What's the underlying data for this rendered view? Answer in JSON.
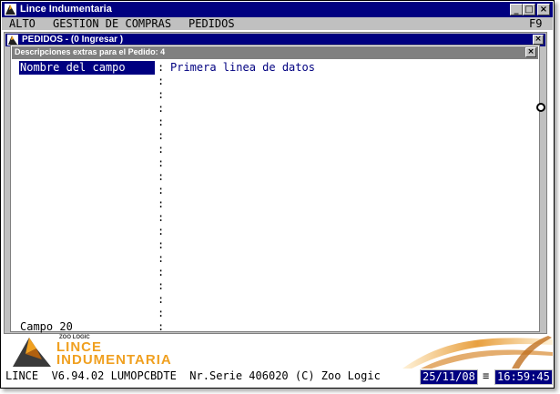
{
  "window": {
    "title": "Lince Indumentaria",
    "minimize_label": "_",
    "maximize_label": "□",
    "close_label": "×"
  },
  "menu": {
    "items": [
      "ALTO",
      "GESTION DE COMPRAS",
      "PEDIDOS"
    ],
    "shortcut": "F9"
  },
  "pedidos_window": {
    "title": "PEDIDOS - (0  Ingresar )",
    "close_label": "×"
  },
  "descripciones_window": {
    "title": "Descripciones extras para el Pedido: 4",
    "close_label": "×"
  },
  "fields": {
    "separator": ":",
    "rows": [
      {
        "name": "Nombre del campo",
        "value": "Primera linea de datos",
        "selected": true
      },
      {
        "name": "",
        "value": ""
      },
      {
        "name": "",
        "value": ""
      },
      {
        "name": "",
        "value": ""
      },
      {
        "name": "",
        "value": ""
      },
      {
        "name": "",
        "value": ""
      },
      {
        "name": "",
        "value": ""
      },
      {
        "name": "",
        "value": ""
      },
      {
        "name": "",
        "value": ""
      },
      {
        "name": "",
        "value": ""
      },
      {
        "name": "",
        "value": ""
      },
      {
        "name": "",
        "value": ""
      },
      {
        "name": "",
        "value": ""
      },
      {
        "name": "",
        "value": ""
      },
      {
        "name": "",
        "value": ""
      },
      {
        "name": "",
        "value": ""
      },
      {
        "name": "",
        "value": ""
      },
      {
        "name": "",
        "value": ""
      },
      {
        "name": "",
        "value": ""
      },
      {
        "name": "Campo 20",
        "value": ""
      }
    ]
  },
  "banner": {
    "company": "ZOO LOGIC",
    "brand_line1": "LINCE",
    "brand_line2": "INDUMENTARIA"
  },
  "status": {
    "text": "LINCE  V6.94.02 LUMOPCBDTE  Nr.Serie 406020 (C) Zoo Logic",
    "date": "25/11/08",
    "separator_glyph": "≡",
    "time": "16:59:45"
  },
  "colors": {
    "title_active": "#000080",
    "title_inactive": "#808080",
    "field_value": "#000080",
    "brand": "#f0a020"
  }
}
